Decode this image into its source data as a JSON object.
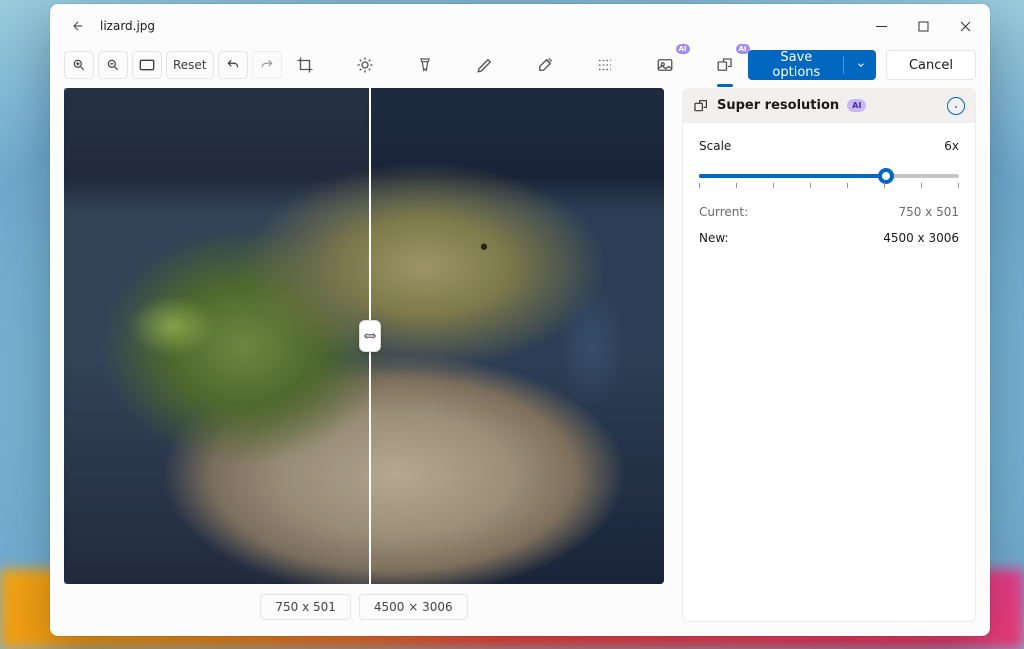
{
  "titlebar": {
    "filename": "lizard.jpg"
  },
  "toolbar": {
    "reset_label": "Reset",
    "ai_badge": "AI",
    "save_label": "Save options",
    "cancel_label": "Cancel"
  },
  "canvas": {
    "before_dimensions": "750 x 501",
    "after_dimensions": "4500 × 3006"
  },
  "panel": {
    "title": "Super resolution",
    "ai_badge": "AI",
    "scale_label": "Scale",
    "scale_value": "6x",
    "scale_percent": 72,
    "current_label": "Current:",
    "current_value": "750 x 501",
    "new_label": "New:",
    "new_value": "4500 x 3006"
  }
}
